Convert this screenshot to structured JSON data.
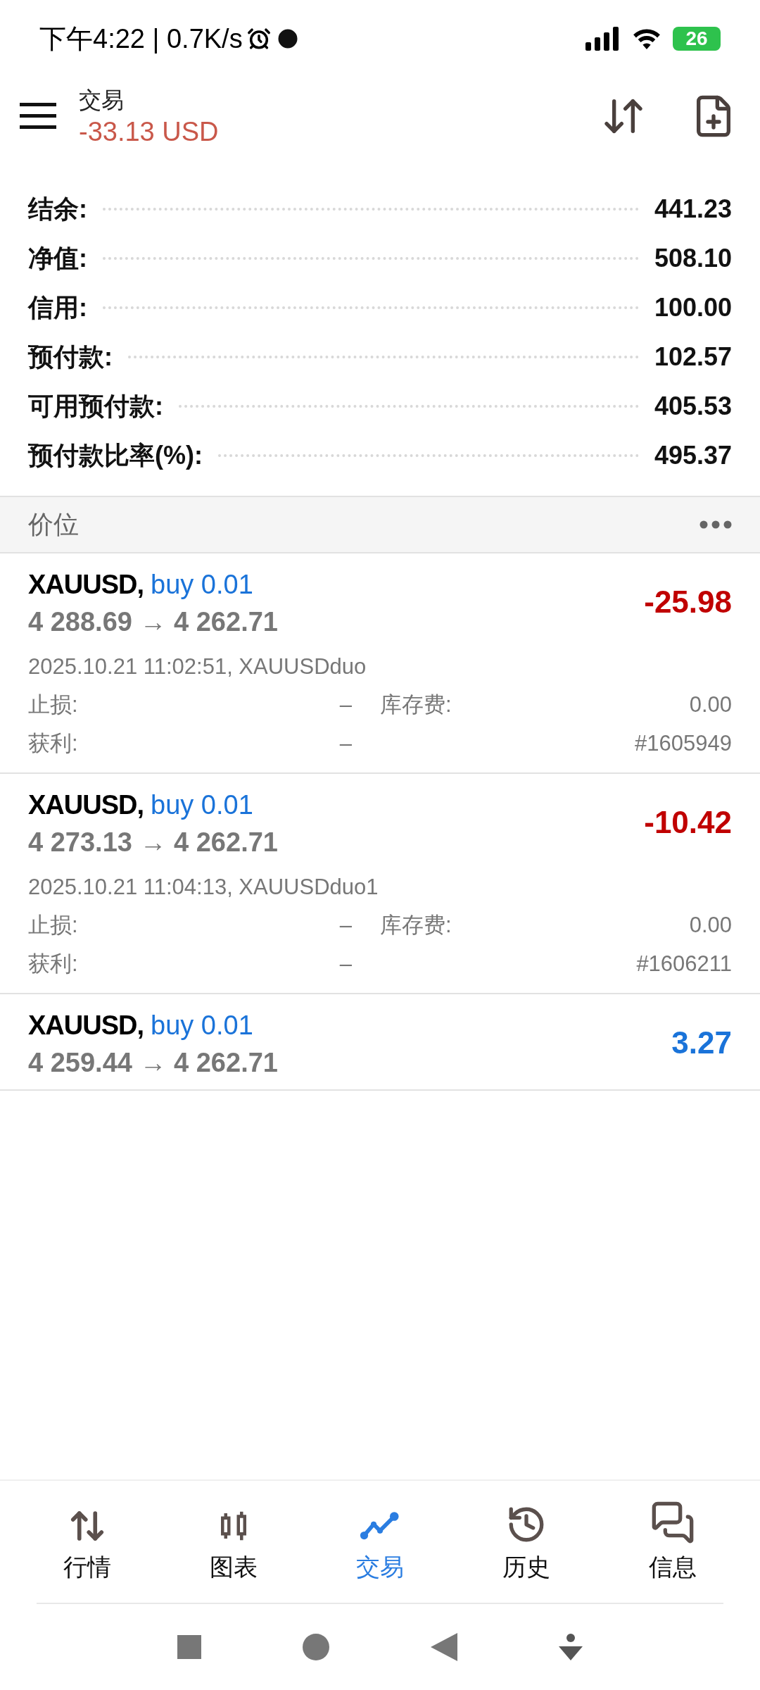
{
  "status_bar": {
    "time": "下午4:22 | 0.7K/s",
    "battery": "26"
  },
  "header": {
    "title": "交易",
    "balance": "-33.13 USD"
  },
  "summary": [
    {
      "label": "结余:",
      "value": "441.23"
    },
    {
      "label": "净值:",
      "value": "508.10"
    },
    {
      "label": "信用:",
      "value": "100.00"
    },
    {
      "label": "预付款:",
      "value": "102.57"
    },
    {
      "label": "可用预付款:",
      "value": "405.53"
    },
    {
      "label": "预付款比率(%):",
      "value": "495.37"
    }
  ],
  "section": {
    "title": "价位"
  },
  "positions": [
    {
      "symbol": "XAUUSD,",
      "side": "buy 0.01",
      "prices": "4 288.69 → 4 262.71",
      "profit": "-25.98",
      "color": "#c00000",
      "expanded": true,
      "time": "2025.10.21 11:02:51, XAUUSDduo",
      "sl_label": "止损:",
      "sl": "–",
      "tp_label": "获利:",
      "tp": "–",
      "swap_label": "库存费:",
      "swap": "0.00",
      "ticket": "#1605949"
    },
    {
      "symbol": "XAUUSD,",
      "side": "buy 0.01",
      "prices": "4 273.13 → 4 262.71",
      "profit": "-10.42",
      "color": "#c00000",
      "expanded": true,
      "time": "2025.10.21 11:04:13, XAUUSDduo1",
      "sl_label": "止损:",
      "sl": "–",
      "tp_label": "获利:",
      "tp": "–",
      "swap_label": "库存费:",
      "swap": "0.00",
      "ticket": "#1606211"
    },
    {
      "symbol": "XAUUSD,",
      "side": "buy 0.01",
      "prices": "4 259.44 → 4 262.71",
      "profit": "3.27",
      "color": "#1a73d9",
      "expanded": false
    }
  ],
  "bottom_nav": [
    {
      "label": "行情",
      "kind": "quotes",
      "selected": false
    },
    {
      "label": "图表",
      "kind": "chart",
      "selected": false
    },
    {
      "label": "交易",
      "kind": "trade",
      "selected": true
    },
    {
      "label": "历史",
      "kind": "history",
      "selected": false
    },
    {
      "label": "信息",
      "kind": "messages",
      "selected": false
    }
  ]
}
